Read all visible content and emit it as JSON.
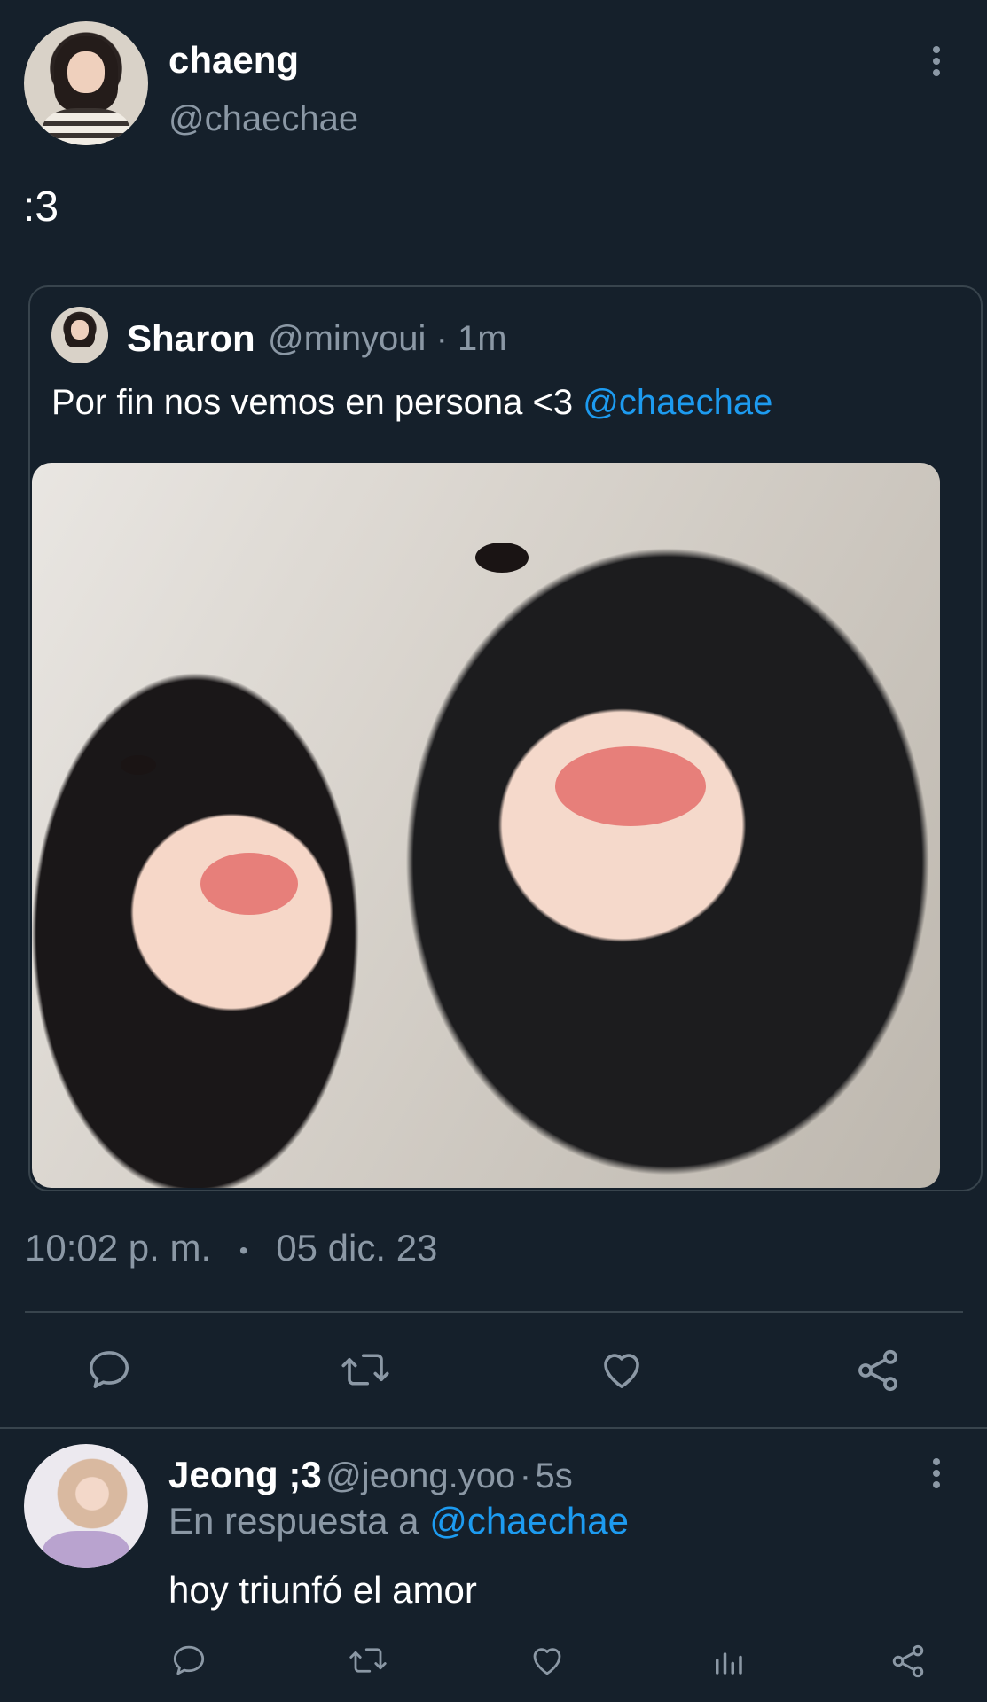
{
  "tweet": {
    "display_name": "chaeng",
    "handle": "@chaechae",
    "text": ":3",
    "time": "10:02 p. m.",
    "separator": "•",
    "date": "05 dic. 23",
    "avatar_icon": "profile-photo"
  },
  "quoted": {
    "display_name": "Sharon",
    "handle": "@minyoui",
    "time_sep": "·",
    "time": "1m",
    "text": "Por fin nos vemos en persona <3 ",
    "mention": "@chaechae",
    "photo_desc_icon": "photo"
  },
  "actions": {
    "reply_icon": "speech-bubble-icon",
    "retweet_icon": "retweet-icon",
    "like_icon": "heart-icon",
    "share_icon": "share-icon"
  },
  "reply": {
    "display_name": "Jeong ;3",
    "handle": "@jeong.yoo",
    "time_sep": "·",
    "time": "5s",
    "in_reply_prefix": "En respuesta a",
    "in_reply_to": "@chaechae",
    "text": "hoy triunfó el amor"
  },
  "colors": {
    "background": "#15202b",
    "muted": "#8b98a5",
    "link": "#1d9bf0",
    "border": "#38444d"
  }
}
